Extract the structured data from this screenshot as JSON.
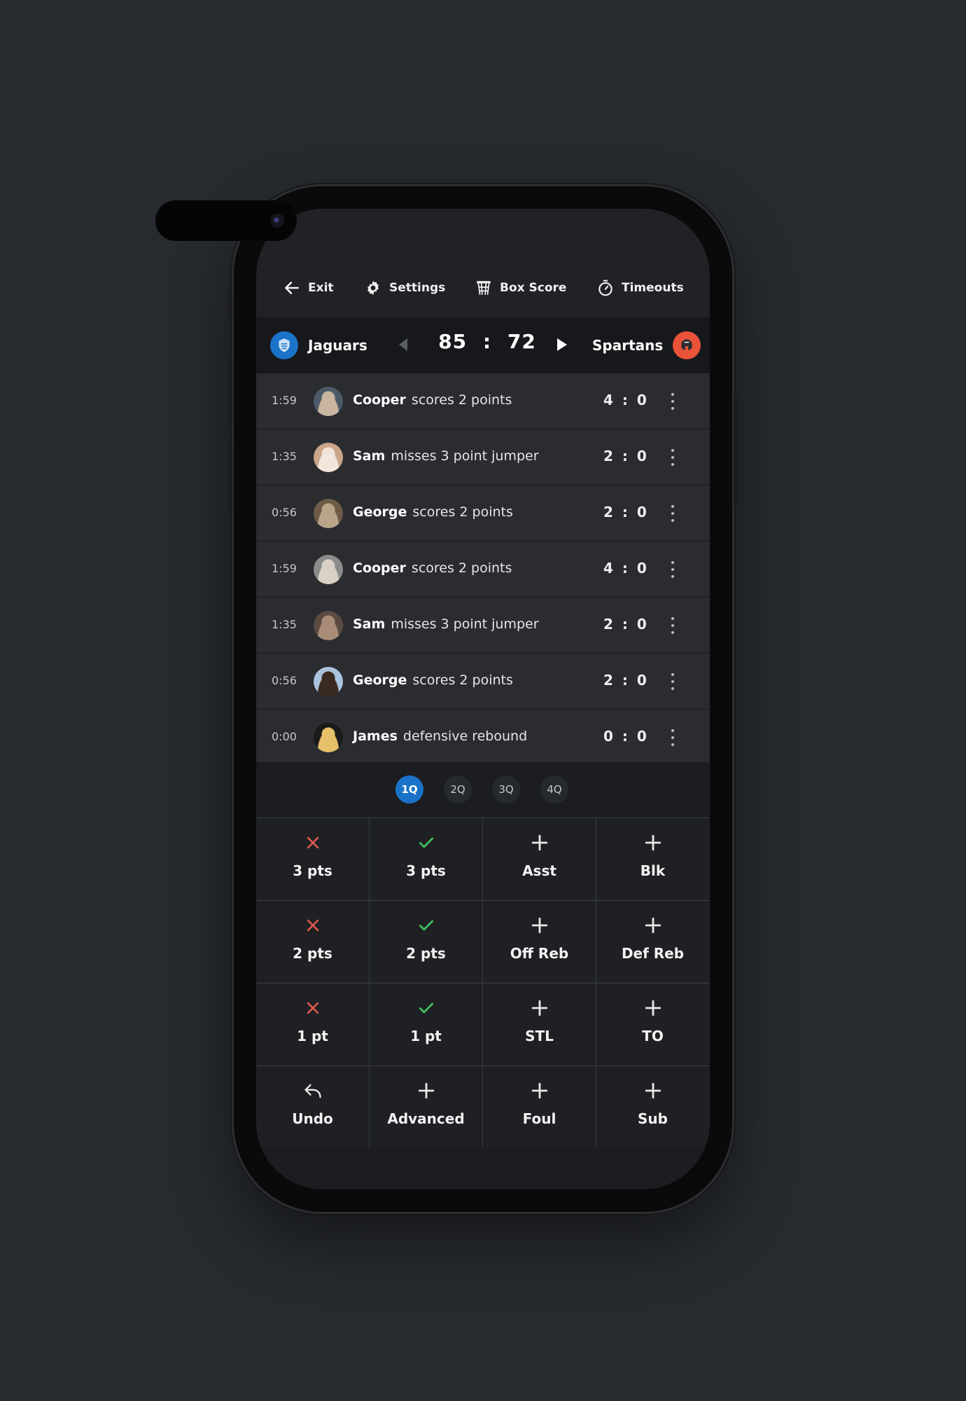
{
  "toolbar": {
    "exit": "Exit",
    "settings": "Settings",
    "box_score": "Box Score",
    "timeouts": "Timeouts"
  },
  "scoreboard": {
    "home_team": "Jaguars",
    "away_team": "Spartans",
    "home_score": "85",
    "separator": ":",
    "away_score": "72",
    "home_color": "#1a73c8",
    "away_color": "#e8533a"
  },
  "feed": [
    {
      "time": "1:59",
      "player": "Cooper",
      "action": "scores 2 points",
      "home": "4",
      "away": "0"
    },
    {
      "time": "1:35",
      "player": "Sam",
      "action": "misses 3 point jumper",
      "home": "2",
      "away": "0"
    },
    {
      "time": "0:56",
      "player": "George",
      "action": "scores 2 points",
      "home": "2",
      "away": "0"
    },
    {
      "time": "1:59",
      "player": "Cooper",
      "action": "scores 2 points",
      "home": "4",
      "away": "0"
    },
    {
      "time": "1:35",
      "player": "Sam",
      "action": "misses 3 point jumper",
      "home": "2",
      "away": "0"
    },
    {
      "time": "0:56",
      "player": "George",
      "action": "scores 2 points",
      "home": "2",
      "away": "0"
    },
    {
      "time": "0:00",
      "player": "James",
      "action": "defensive rebound",
      "home": "0",
      "away": "0"
    }
  ],
  "quarters": {
    "items": [
      "1Q",
      "2Q",
      "3Q",
      "4Q"
    ],
    "active": "1Q"
  },
  "pad": [
    {
      "label": "3 pts",
      "icon": "x-icon"
    },
    {
      "label": "3 pts",
      "icon": "check-icon"
    },
    {
      "label": "Asst",
      "icon": "plus-icon"
    },
    {
      "label": "Blk",
      "icon": "plus-icon"
    },
    {
      "label": "2 pts",
      "icon": "x-icon"
    },
    {
      "label": "2 pts",
      "icon": "check-icon"
    },
    {
      "label": "Off Reb",
      "icon": "plus-icon"
    },
    {
      "label": "Def Reb",
      "icon": "plus-icon"
    },
    {
      "label": "1 pt",
      "icon": "x-icon"
    },
    {
      "label": "1 pt",
      "icon": "check-icon"
    },
    {
      "label": "STL",
      "icon": "plus-icon"
    },
    {
      "label": "TO",
      "icon": "plus-icon"
    },
    {
      "label": "Undo",
      "icon": "undo-icon"
    },
    {
      "label": "Advanced",
      "icon": "plus-icon"
    },
    {
      "label": "Foul",
      "icon": "plus-icon"
    },
    {
      "label": "Sub",
      "icon": "plus-icon"
    }
  ],
  "colors": {
    "miss": "#e05a4f",
    "make": "#3fbf62",
    "accent": "#1a73c8"
  }
}
